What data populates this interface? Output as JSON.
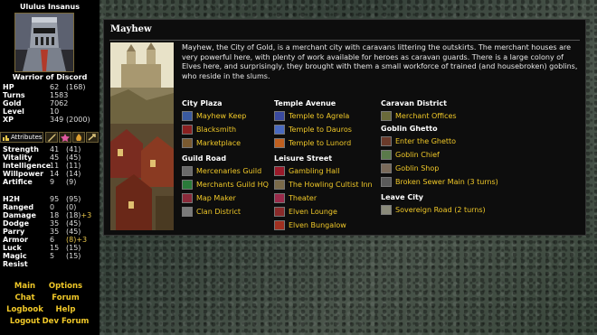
{
  "sidebar": {
    "char_name": "Ululus Insanus",
    "title": "Warrior of Discord",
    "stats": [
      {
        "label": "HP",
        "value": "62",
        "max": "(168)"
      },
      {
        "label": "Turns",
        "value": "1583",
        "max": ""
      },
      {
        "label": "Gold",
        "value": "7062",
        "max": ""
      },
      {
        "label": "Level",
        "value": "10",
        "max": ""
      },
      {
        "label": "XP",
        "value": "349",
        "max": "(2000)"
      }
    ],
    "attributes_tab": "Attributes",
    "attributes": [
      {
        "label": "Strength",
        "value": "41",
        "max": "(41)"
      },
      {
        "label": "Vitality",
        "value": "45",
        "max": "(45)"
      },
      {
        "label": "Intelligence",
        "value": "11",
        "max": "(11)"
      },
      {
        "label": "Willpower",
        "value": "14",
        "max": "(14)"
      },
      {
        "label": "Artifice",
        "value": "9",
        "max": "(9)"
      }
    ],
    "combat": [
      {
        "label": "H2H",
        "value": "95",
        "max": "(95)",
        "bonus": ""
      },
      {
        "label": "Ranged",
        "value": "0",
        "max": "(0)",
        "bonus": ""
      },
      {
        "label": "Damage",
        "value": "18",
        "max": "(18)",
        "bonus": "+3"
      },
      {
        "label": "Dodge",
        "value": "35",
        "max": "(45)",
        "bonus": ""
      },
      {
        "label": "Parry",
        "value": "35",
        "max": "(45)",
        "bonus": ""
      },
      {
        "label": "Armor",
        "value": "6",
        "max": "(8)",
        "bonus": "+3"
      },
      {
        "label": "Luck",
        "value": "15",
        "max": "(15)",
        "bonus": ""
      },
      {
        "label": "Magic Resist",
        "value": "5",
        "max": "(15)",
        "bonus": ""
      }
    ],
    "menu": {
      "main": "Main",
      "options": "Options",
      "chat": "Chat",
      "forum": "Forum",
      "logbook": "Logbook",
      "help": "Help",
      "logout": "Logout",
      "devforum": "Dev Forum"
    }
  },
  "location": {
    "name": "Mayhew",
    "description": "Mayhew, the City of Gold, is a merchant city with caravans littering the outskirts. The merchant houses are very powerful here, with plenty of work available for heroes as caravan guards. There is a large colony of Elves here, and surprisingly, they brought with them a small workforce of trained (and housebroken) goblins, who reside in the slums.",
    "city_plaza": {
      "title": "City Plaza",
      "items": [
        "Mayhew Keep",
        "Blacksmith",
        "Marketplace"
      ]
    },
    "guild_road": {
      "title": "Guild Road",
      "items": [
        "Mercenaries Guild",
        "Merchants Guild HQ",
        "Map Maker",
        "Clan District"
      ]
    },
    "temple_avenue": {
      "title": "Temple Avenue",
      "items": [
        "Temple to Agrela",
        "Temple to Dauros",
        "Temple to Lunord"
      ]
    },
    "leisure_street": {
      "title": "Leisure Street",
      "items": [
        "Gambling Hall",
        "The Howling Cultist Inn",
        "Theater",
        "Elven Lounge",
        "Elven Bungalow"
      ]
    },
    "caravan_district": {
      "title": "Caravan District",
      "items": [
        "Merchant Offices"
      ]
    },
    "goblin_ghetto": {
      "title": "Goblin Ghetto",
      "items": [
        "Enter the Ghetto",
        "Goblin Chief",
        "Goblin Shop",
        "Broken Sewer Main (3 turns)"
      ]
    },
    "leave_city": {
      "title": "Leave City",
      "items": [
        "Sovereign Road (2 turns)"
      ]
    }
  }
}
